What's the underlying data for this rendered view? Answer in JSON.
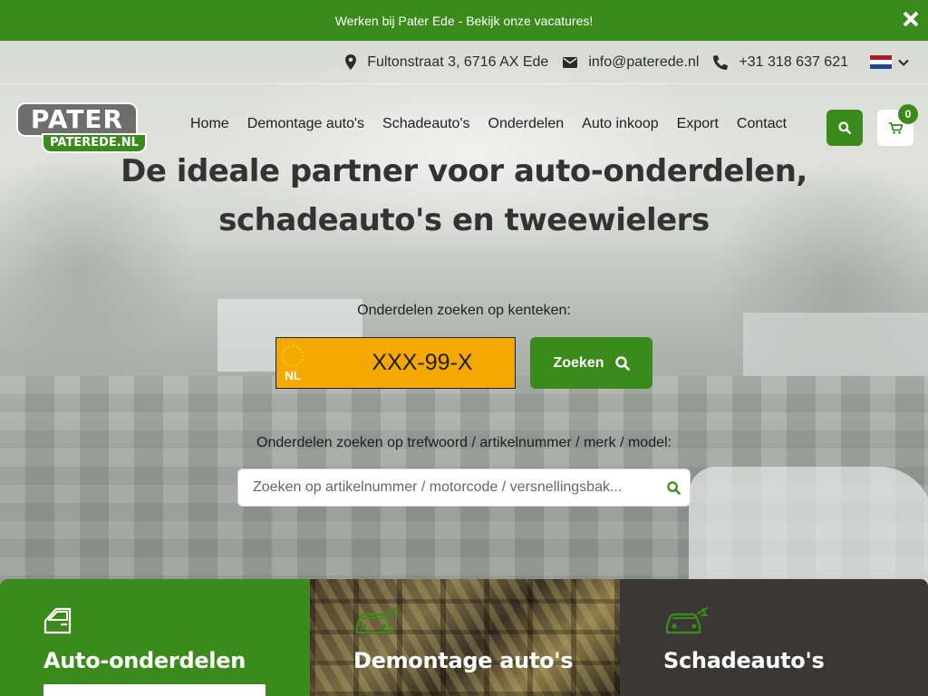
{
  "announcement": {
    "text": "Werken bij Pater Ede - Bekijk onze vacatures!"
  },
  "contact": {
    "address": "Fultonstraat 3, 6716 AX Ede",
    "email": "info@paterede.nl",
    "phone": "+31 318 637 621"
  },
  "logo": {
    "top": "PATER",
    "bottom": "PATEREDE.NL"
  },
  "nav": {
    "items": [
      "Home",
      "Demontage auto's",
      "Schadeauto's",
      "Onderdelen",
      "Auto inkoop",
      "Export",
      "Contact"
    ],
    "cart_count": "0"
  },
  "hero": {
    "title_line1": "De ideale partner voor auto-onderdelen,",
    "title_line2": "schadeauto's en tweewielers",
    "plate_label": "Onderdelen zoeken op kenteken:",
    "plate_country": "NL",
    "plate_placeholder": "XXX-99-X",
    "search_button": "Zoeken",
    "keyword_label": "Onderdelen zoeken op trefwoord / artikelnummer / merk / model:",
    "keyword_placeholder": "Zoeken op artikelnummer / motorcode / versnellingsbak..."
  },
  "tiles": [
    {
      "name": "Auto-onderdelen",
      "icon": "car-door-icon"
    },
    {
      "name": "Demontage auto's",
      "icon": "damaged-car-icon"
    },
    {
      "name": "Schadeauto's",
      "icon": "damaged-car-icon"
    }
  ],
  "colors": {
    "brand_green": "#3a8a1c",
    "plate_yellow": "#f5a800",
    "eu_blue": "#0a3d9c"
  }
}
